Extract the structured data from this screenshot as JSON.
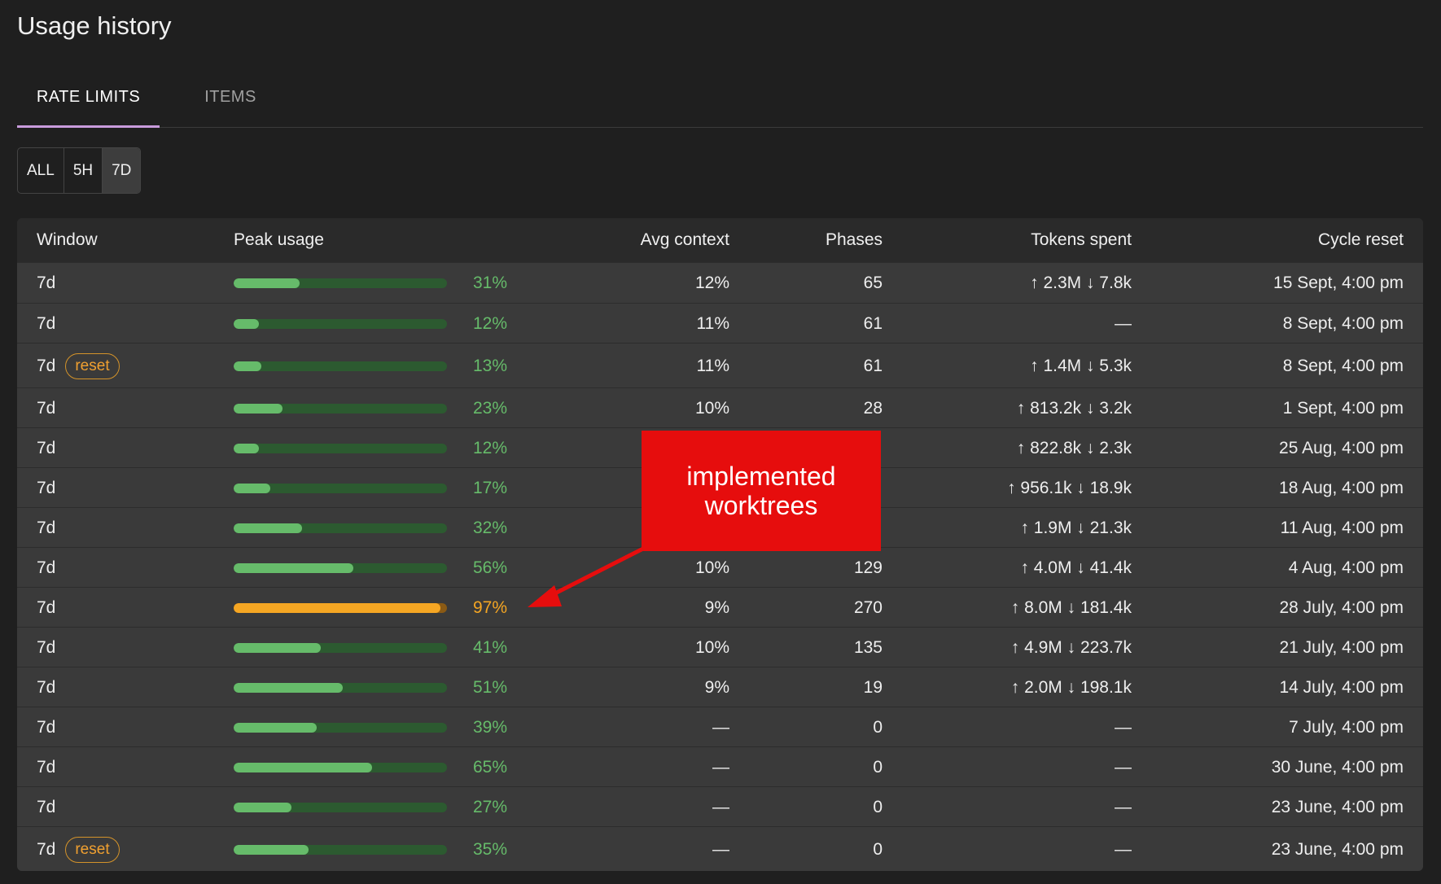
{
  "page": {
    "title": "Usage history"
  },
  "tabs": [
    {
      "label": "RATE LIMITS",
      "active": true
    },
    {
      "label": "ITEMS",
      "active": false
    }
  ],
  "filter": {
    "options": [
      "ALL",
      "5H",
      "7D"
    ],
    "selected": "7D"
  },
  "table": {
    "headers": {
      "window": "Window",
      "peak": "Peak usage",
      "avg": "Avg context",
      "phases": "Phases",
      "tokens": "Tokens spent",
      "reset": "Cycle reset"
    },
    "rows": [
      {
        "window": "7d",
        "badge": "",
        "peak": 0.31,
        "peak_label": "31%",
        "avg": "12%",
        "phases": "65",
        "tokens": "↑ 2.3M ↓ 7.8k",
        "reset": "15 Sept, 4:00 pm"
      },
      {
        "window": "7d",
        "badge": "",
        "peak": 0.12,
        "peak_label": "12%",
        "avg": "11%",
        "phases": "61",
        "tokens": "—",
        "reset": "8 Sept, 4:00 pm"
      },
      {
        "window": "7d",
        "badge": "reset",
        "peak": 0.13,
        "peak_label": "13%",
        "avg": "11%",
        "phases": "61",
        "tokens": "↑ 1.4M ↓ 5.3k",
        "reset": "8 Sept, 4:00 pm"
      },
      {
        "window": "7d",
        "badge": "",
        "peak": 0.23,
        "peak_label": "23%",
        "avg": "10%",
        "phases": "28",
        "tokens": "↑ 813.2k ↓ 3.2k",
        "reset": "1 Sept, 4:00 pm"
      },
      {
        "window": "7d",
        "badge": "",
        "peak": 0.12,
        "peak_label": "12%",
        "avg": "",
        "phases": "",
        "tokens": "↑ 822.8k ↓ 2.3k",
        "reset": "25 Aug, 4:00 pm"
      },
      {
        "window": "7d",
        "badge": "",
        "peak": 0.17,
        "peak_label": "17%",
        "avg": "",
        "phases": "",
        "tokens": "↑ 956.1k ↓ 18.9k",
        "reset": "18 Aug, 4:00 pm"
      },
      {
        "window": "7d",
        "badge": "",
        "peak": 0.32,
        "peak_label": "32%",
        "avg": "",
        "phases": "",
        "tokens": "↑ 1.9M ↓ 21.3k",
        "reset": "11 Aug, 4:00 pm"
      },
      {
        "window": "7d",
        "badge": "",
        "peak": 0.56,
        "peak_label": "56%",
        "avg": "10%",
        "phases": "129",
        "tokens": "↑ 4.0M ↓ 41.4k",
        "reset": "4 Aug, 4:00 pm"
      },
      {
        "window": "7d",
        "badge": "",
        "peak": 0.97,
        "peak_label": "97%",
        "avg": "9%",
        "phases": "270",
        "tokens": "↑ 8.0M ↓ 181.4k",
        "reset": "28 July, 4:00 pm",
        "warn": true
      },
      {
        "window": "7d",
        "badge": "",
        "peak": 0.41,
        "peak_label": "41%",
        "avg": "10%",
        "phases": "135",
        "tokens": "↑ 4.9M ↓ 223.7k",
        "reset": "21 July, 4:00 pm"
      },
      {
        "window": "7d",
        "badge": "",
        "peak": 0.51,
        "peak_label": "51%",
        "avg": "9%",
        "phases": "19",
        "tokens": "↑ 2.0M ↓ 198.1k",
        "reset": "14 July, 4:00 pm"
      },
      {
        "window": "7d",
        "badge": "",
        "peak": 0.39,
        "peak_label": "39%",
        "avg": "—",
        "phases": "0",
        "tokens": "—",
        "reset": "7 July, 4:00 pm"
      },
      {
        "window": "7d",
        "badge": "",
        "peak": 0.65,
        "peak_label": "65%",
        "avg": "—",
        "phases": "0",
        "tokens": "—",
        "reset": "30 June, 4:00 pm"
      },
      {
        "window": "7d",
        "badge": "",
        "peak": 0.27,
        "peak_label": "27%",
        "avg": "—",
        "phases": "0",
        "tokens": "—",
        "reset": "23 June, 4:00 pm"
      },
      {
        "window": "7d",
        "badge": "reset",
        "peak": 0.35,
        "peak_label": "35%",
        "avg": "—",
        "phases": "0",
        "tokens": "—",
        "reset": "23 June, 4:00 pm"
      }
    ]
  },
  "annotation": {
    "line1": "implemented",
    "line2": "worktrees"
  },
  "colors": {
    "accent_tab": "#c89bdc",
    "ok": "#66bb6a",
    "warn": "#f5a623",
    "callout": "#e60d0d"
  }
}
